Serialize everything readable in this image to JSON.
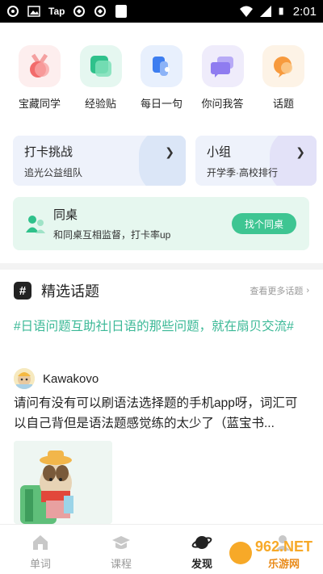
{
  "status_bar": {
    "carrier_label": "Tap",
    "time": "2:01",
    "icons": [
      "gallery-icon",
      "wifi-icon",
      "signal-icon",
      "battery-icon"
    ]
  },
  "quick_items": [
    {
      "label": "宝藏同学",
      "icon": "medal-icon",
      "bg": "#fdeeee",
      "color": "#f26b6b"
    },
    {
      "label": "经验贴",
      "icon": "note-icon",
      "bg": "#e5f7f0",
      "color": "#2fc18b"
    },
    {
      "label": "每日一句",
      "icon": "quote-icon",
      "bg": "#e8f0fd",
      "color": "#3e7ef0"
    },
    {
      "label": "你问我答",
      "icon": "chat-icon",
      "bg": "#efecfb",
      "color": "#8f7cf0"
    },
    {
      "label": "话题",
      "icon": "topic-bubble-icon",
      "bg": "#fdf3e6",
      "color": "#f79a3d"
    }
  ],
  "cards": [
    {
      "title": "打卡挑战",
      "subtitle": "追光公益组队"
    },
    {
      "title": "小组",
      "subtitle": "开学季·高校排行"
    }
  ],
  "desk_mate": {
    "title": "同桌",
    "subtitle": "和同桌互相监督，打卡率up",
    "button": "找个同桌"
  },
  "featured": {
    "title": "精选话题",
    "more": "查看更多话题",
    "topic_link": "#日语问题互助社|日语的那些问题，就在扇贝交流#",
    "author": "Kawakovo",
    "post_text": "请问有没有可以刷语法选择题的手机app呀，词汇可以自己背但是语法题感觉练的太少了（蓝宝书..."
  },
  "bottom_nav": [
    {
      "label": "单词",
      "icon": "home-icon",
      "active": false
    },
    {
      "label": "课程",
      "icon": "graduation-cap-icon",
      "active": false
    },
    {
      "label": "发现",
      "icon": "planet-icon",
      "active": true
    },
    {
      "label": "",
      "icon": "profile-icon",
      "active": false
    }
  ],
  "watermark": {
    "text": "962.NET",
    "subtext": "乐游网"
  },
  "colors": {
    "accent_green": "#3ec592",
    "topic_green": "#3ab896",
    "card_bg": "#eef2fb",
    "desk_bg": "#e6f7ef"
  }
}
